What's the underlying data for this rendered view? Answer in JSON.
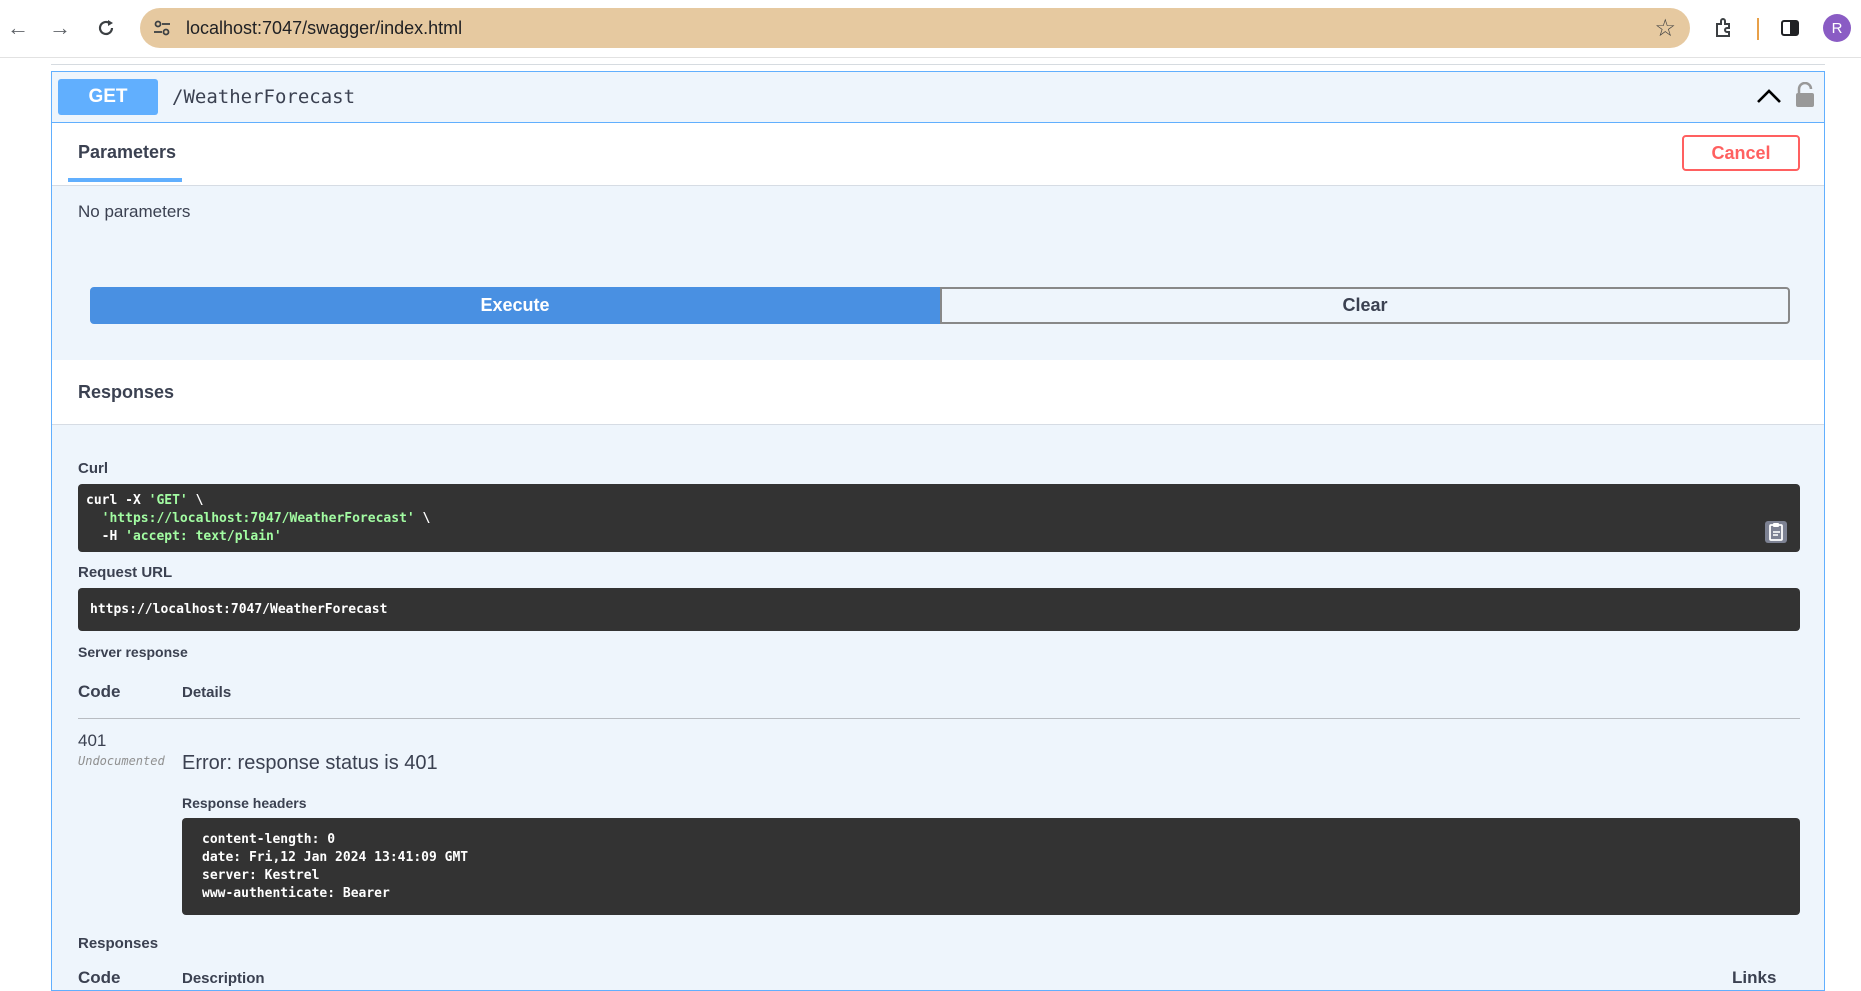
{
  "browser": {
    "url": "localhost:7047/swagger/index.html",
    "profile_initial": "R",
    "accent_omnibox": "#e6c9a0"
  },
  "operation": {
    "method": "GET",
    "path": "/WeatherForecast"
  },
  "parameters": {
    "tab_label": "Parameters",
    "cancel_label": "Cancel",
    "empty_text": "No parameters"
  },
  "actions": {
    "execute_label": "Execute",
    "clear_label": "Clear"
  },
  "responses_section": {
    "title": "Responses"
  },
  "curl": {
    "label": "Curl",
    "line1_cmd": "curl -X ",
    "line1_str": "'GET'",
    "line1_tail": " \\",
    "line2_str": "  'https://localhost:7047/WeatherForecast'",
    "line2_tail": " \\",
    "line3_cmd": "  -H ",
    "line3_str": "'accept: text/plain'"
  },
  "request_url": {
    "label": "Request URL",
    "value": "https://localhost:7047/WeatherForecast"
  },
  "server_response": {
    "label": "Server response",
    "col_code": "Code",
    "col_details": "Details",
    "status_code": "401",
    "undocumented": "Undocumented",
    "error_text": "Error: response status is 401",
    "headers_label": "Response headers",
    "headers": [
      "content-length: 0",
      "date: Fri,12 Jan 2024 13:41:09 GMT",
      "server: Kestrel",
      "www-authenticate: Bearer"
    ]
  },
  "responses_table": {
    "label": "Responses",
    "col_code": "Code",
    "col_description": "Description",
    "col_links": "Links"
  },
  "colors": {
    "get_method": "#61affe",
    "execute": "#4990e2",
    "cancel": "#ff6060",
    "code_bg": "#333333"
  }
}
